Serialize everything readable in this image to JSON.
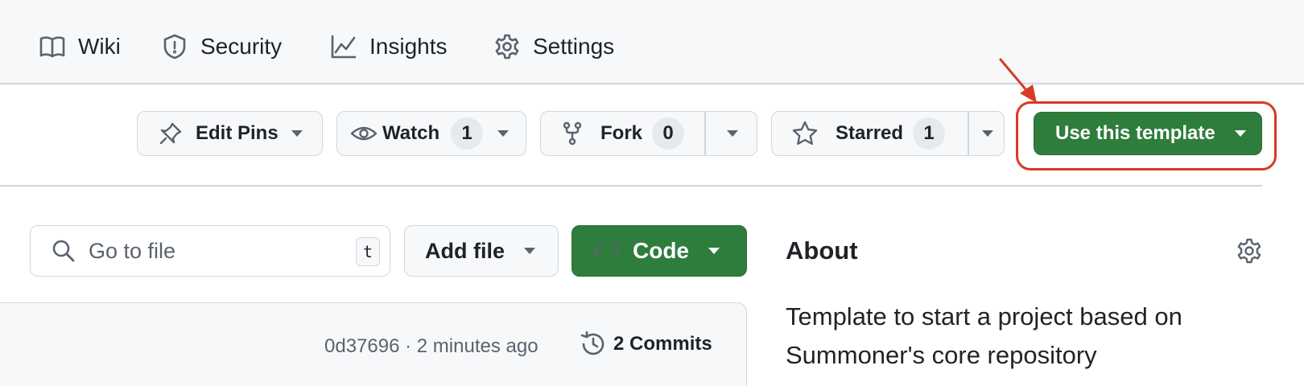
{
  "nav": {
    "items": [
      {
        "label": "Wiki",
        "icon": "book-icon"
      },
      {
        "label": "Security",
        "icon": "shield-icon"
      },
      {
        "label": "Insights",
        "icon": "graph-icon"
      },
      {
        "label": "Settings",
        "icon": "gear-icon"
      }
    ]
  },
  "actions": {
    "edit_pins": "Edit Pins",
    "watch": {
      "label": "Watch",
      "count": "1"
    },
    "fork": {
      "label": "Fork",
      "count": "0"
    },
    "starred": {
      "label": "Starred",
      "count": "1"
    },
    "use_template": "Use this template"
  },
  "file_bar": {
    "search_placeholder": "Go to file",
    "shortcut": "t",
    "add_file": "Add file",
    "code": "Code"
  },
  "commit": {
    "hash": "0d37696",
    "separator": "·",
    "time": "2 minutes ago",
    "commits": "2 Commits"
  },
  "about": {
    "title": "About",
    "description": "Template to start a project based on Summoner's core repository"
  },
  "colors": {
    "primary_green": "#2f7d3c",
    "annotation_red": "#d63b23",
    "star_yellow": "#eac54f"
  }
}
